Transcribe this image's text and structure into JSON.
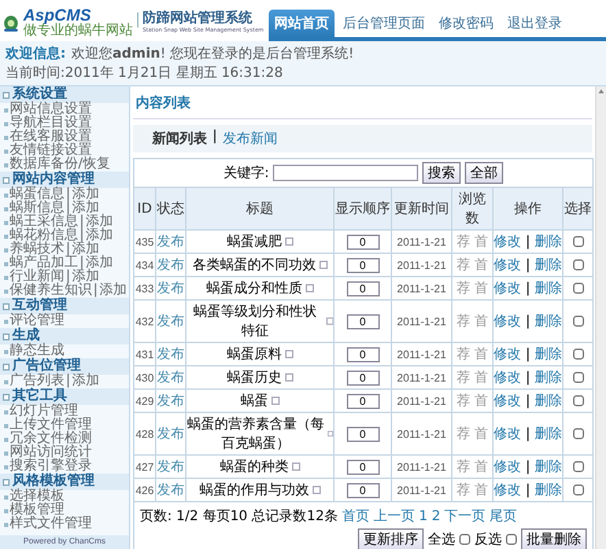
{
  "header": {
    "logo": {
      "brand": "AspCMS",
      "slogan": "做专业的蜗牛网站",
      "system_name": "防蹄网站管理系统",
      "system_subtitle": "Station Snap Web Site Management System"
    },
    "tabs": [
      {
        "label": "网站首页",
        "selected": true
      },
      {
        "label": "后台管理页面",
        "selected": false
      },
      {
        "label": "修改密码",
        "selected": false
      },
      {
        "label": "退出登录",
        "selected": false
      }
    ],
    "welcome": {
      "label": "欢迎信息:",
      "message": "欢迎您**admin**! 您现在登录的是后台管理系统!",
      "time": "当前时间:2011年 1月21日 星期五 16:31:28"
    }
  },
  "sidebar": {
    "sections": [
      {
        "title": "系统设置",
        "items": [
          {
            "label": "网站信息设置"
          },
          {
            "label": "导航栏目设置"
          },
          {
            "label": "在线客服设置"
          },
          {
            "label": "友情链接设置"
          },
          {
            "label": "数据库备份/恢复"
          }
        ]
      },
      {
        "title": "网站内容管理",
        "items": [
          {
            "label": "蜗蛋信息",
            "separator": "|",
            "action": "添加"
          },
          {
            "label": "蜗斯信息",
            "separator": "|",
            "action": "添加"
          },
          {
            "label": "蜗王采信息",
            "separator": "|",
            "action": "添加"
          },
          {
            "label": "蜗花粉信息",
            "separator": "|",
            "action": "添加"
          },
          {
            "label": "养蜗技术",
            "separator": "|",
            "action": "添加"
          },
          {
            "label": "蜗产品加工",
            "separator": "|",
            "action": "添加"
          },
          {
            "label": "行业新闻",
            "separator": "|",
            "action": "添加"
          },
          {
            "label": "保健养生知识",
            "separator": "|",
            "action": "添加"
          }
        ]
      },
      {
        "title": "互动管理",
        "items": [
          {
            "label": "评论管理"
          }
        ]
      },
      {
        "title": "生成",
        "items": [
          {
            "label": "静态生成"
          }
        ]
      },
      {
        "title": "广告位管理",
        "items": [
          {
            "label": "广告列表",
            "separator": "|",
            "action": "添加"
          }
        ]
      },
      {
        "title": "其它工具",
        "items": [
          {
            "label": "幻灯片管理"
          },
          {
            "label": "上传文件管理"
          },
          {
            "label": "冗余文件检测"
          },
          {
            "label": "网站访问统计"
          },
          {
            "label": "搜索引擎登录"
          }
        ]
      },
      {
        "title": "风格模板管理",
        "items": [
          {
            "label": "选择模板"
          },
          {
            "label": "模板管理"
          },
          {
            "label": "样式文件管理"
          }
        ]
      }
    ],
    "footer": "Powered by ChanCms"
  },
  "content": {
    "title": "内容列表",
    "subtabs": [
      {
        "label": "新闻列表",
        "selected": true
      },
      {
        "label": "发布新闻",
        "selected": false
      }
    ],
    "subtab_separator": "|",
    "search": {
      "label": "关键字:",
      "buttons": [
        "搜索",
        "全部"
      ]
    },
    "table": {
      "columns": [
        "ID",
        "状态",
        "标题",
        "显示顺序",
        "更新时间",
        "浏览数",
        "操作",
        "选择"
      ],
      "rows": [
        {
          "id": "435",
          "status": "发布",
          "title": "蜗蛋减肥",
          "order": "0",
          "date": "2011-1-21",
          "flags": [
            "荐",
            "首"
          ],
          "edit": "修改",
          "separator": "|",
          "delete": "删除",
          "checked": false
        },
        {
          "id": "434",
          "status": "发布",
          "title": "各类蜗蛋的不同功效",
          "order": "0",
          "date": "2011-1-21",
          "flags": [
            "荐",
            "首"
          ],
          "edit": "修改",
          "separator": "|",
          "delete": "删除",
          "checked": false
        },
        {
          "id": "433",
          "status": "发布",
          "title": "蜗蛋成分和性质",
          "order": "0",
          "date": "2011-1-21",
          "flags": [
            "荐",
            "首"
          ],
          "edit": "修改",
          "separator": "|",
          "delete": "删除",
          "checked": false
        },
        {
          "id": "432",
          "status": "发布",
          "title": "蜗蛋等级划分和性状特征",
          "order": "0",
          "date": "2011-1-21",
          "flags": [
            "荐",
            "首"
          ],
          "edit": "修改",
          "separator": "|",
          "delete": "删除",
          "checked": false
        },
        {
          "id": "431",
          "status": "发布",
          "title": "蜗蛋原料",
          "order": "0",
          "date": "2011-1-21",
          "flags": [
            "荐",
            "首"
          ],
          "edit": "修改",
          "separator": "|",
          "delete": "删除",
          "checked": false
        },
        {
          "id": "430",
          "status": "发布",
          "title": "蜗蛋历史",
          "order": "0",
          "date": "2011-1-21",
          "flags": [
            "荐",
            "首"
          ],
          "edit": "修改",
          "separator": "|",
          "delete": "删除",
          "checked": false
        },
        {
          "id": "429",
          "status": "发布",
          "title": "蜗蛋",
          "order": "0",
          "date": "2011-1-21",
          "flags": [
            "荐",
            "首"
          ],
          "edit": "修改",
          "separator": "|",
          "delete": "删除",
          "checked": false
        },
        {
          "id": "428",
          "status": "发布",
          "title": "蜗蛋的营养素含量（每百克蜗蛋）",
          "order": "0",
          "date": "2011-1-21",
          "flags": [
            "荐",
            "首"
          ],
          "edit": "修改",
          "separator": "|",
          "delete": "删除",
          "checked": false
        },
        {
          "id": "427",
          "status": "发布",
          "title": "蜗蛋的种类",
          "order": "0",
          "date": "2011-1-21",
          "flags": [
            "荐",
            "首"
          ],
          "edit": "修改",
          "separator": "|",
          "delete": "删除",
          "checked": false
        },
        {
          "id": "426",
          "status": "发布",
          "title": "蜗蛋的作用与功效",
          "order": "0",
          "date": "2011-1-21",
          "flags": [
            "荐",
            "首"
          ],
          "edit": "修改",
          "separator": "|",
          "delete": "删除",
          "checked": false
        }
      ]
    },
    "pagination": {
      "summary": "页数: 1/2 每页10 总记录数12条",
      "links": [
        "首页",
        "上一页",
        "1",
        "2",
        "下一页",
        "尾页"
      ]
    },
    "actions": {
      "update_button": "更新排序",
      "select_all": {
        "label": "全选",
        "checked": false
      },
      "invert": {
        "label": "反选",
        "checked": false
      },
      "delete_button": "批量删除"
    }
  }
}
